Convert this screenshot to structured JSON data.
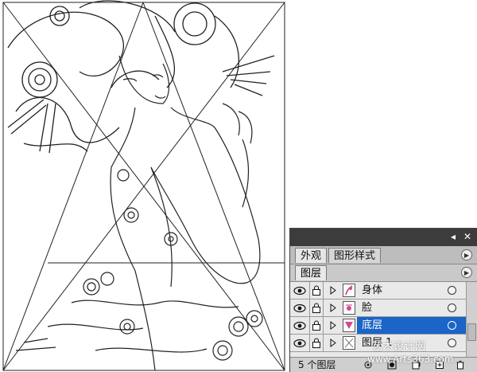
{
  "panel": {
    "tabs": [
      {
        "label": "外观"
      },
      {
        "label": "图形样式"
      }
    ],
    "layers_tab": "图层",
    "layers": [
      {
        "name": "身体",
        "selected": false
      },
      {
        "name": "脸",
        "selected": false
      },
      {
        "name": "底层",
        "selected": true
      },
      {
        "name": "图层 1",
        "selected": false
      }
    ],
    "footer_count": "5 个图层",
    "close_symbol": "✕",
    "collapse_symbol": "◂"
  },
  "watermark": {
    "line1": "艺术设计网",
    "line2": "www.Arts363.com"
  },
  "colors": {
    "selection": "#1b64c8",
    "panel_bg": "#d8d8d8",
    "titlebar": "#3c3c3c",
    "artboard_stroke": "#222222"
  }
}
